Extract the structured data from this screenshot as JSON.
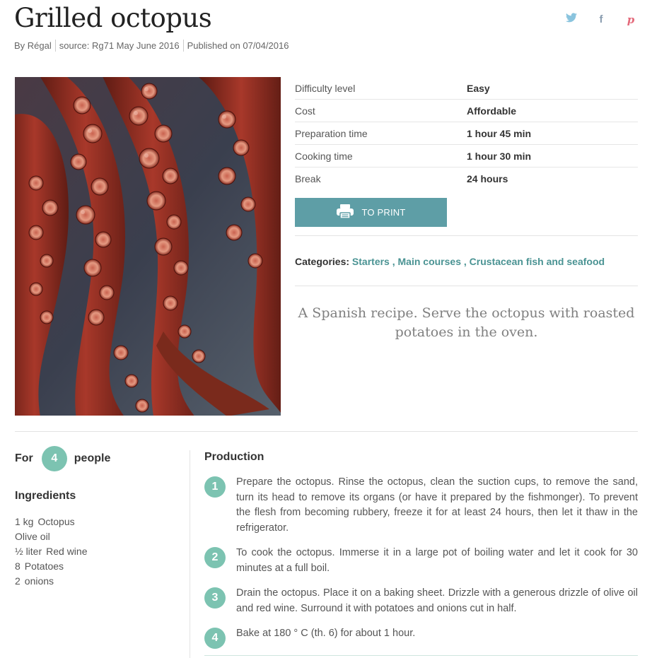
{
  "recipe": {
    "title": "Grilled octopus",
    "byline": {
      "author": "By Régal",
      "source": "source: Rg71 May June 2016",
      "published": "Published on 07/04/2016"
    },
    "social": {
      "twitter_icon": "twitter-icon",
      "facebook_icon": "facebook-icon",
      "pinterest_icon": "pinterest-icon"
    },
    "photo_alt": "octopus-photo",
    "info": [
      {
        "key": "Difficulty level",
        "value": "Easy"
      },
      {
        "key": "Cost",
        "value": "Affordable"
      },
      {
        "key": "Preparation time",
        "value": "1 hour 45 min"
      },
      {
        "key": "Cooking time",
        "value": "1 hour 30 min"
      },
      {
        "key": "Break",
        "value": "24 hours"
      }
    ],
    "print_label": "TO PRINT",
    "categories": {
      "label": "Categories:",
      "items": [
        "Starters",
        "Main courses",
        "Crustacean fish and seafood"
      ]
    },
    "lead": "A Spanish recipe. Serve the octopus with roasted potatoes in the oven.",
    "servings": {
      "for": "For",
      "count": "4",
      "unit": "people"
    },
    "ingredients_title": "Ingredients",
    "ingredients": [
      {
        "qty": "1 kg",
        "name": "Octopus"
      },
      {
        "qty": "",
        "name": "Olive oil"
      },
      {
        "qty": "½ liter",
        "name": "Red wine"
      },
      {
        "qty": "8",
        "name": "Potatoes"
      },
      {
        "qty": "2",
        "name": "onions"
      }
    ],
    "production_title": "Production",
    "steps": [
      {
        "n": "1",
        "text": "Prepare the octopus. Rinse the octopus, clean the suction cups, to remove the sand, turn its head to remove its organs (or have it prepared by the fishmonger). To prevent the flesh from becoming rubbery, freeze it for at least 24 hours, then let it thaw in the refrigerator."
      },
      {
        "n": "2",
        "text": "To cook the octopus. Immerse it in a large pot of boiling water and let it cook for 30 minutes at a full boil."
      },
      {
        "n": "3",
        "text": "Drain the octopus. Place it on a baking sheet. Drizzle with a generous drizzle of olive oil and red wine. Surround it with potatoes and onions cut in half."
      },
      {
        "n": "4",
        "text": "Bake at 180 ° C (th. 6) for about 1 hour."
      }
    ]
  },
  "colors": {
    "accent": "#7cc3b1",
    "button": "#5e9ea6",
    "link": "#4a9393"
  }
}
